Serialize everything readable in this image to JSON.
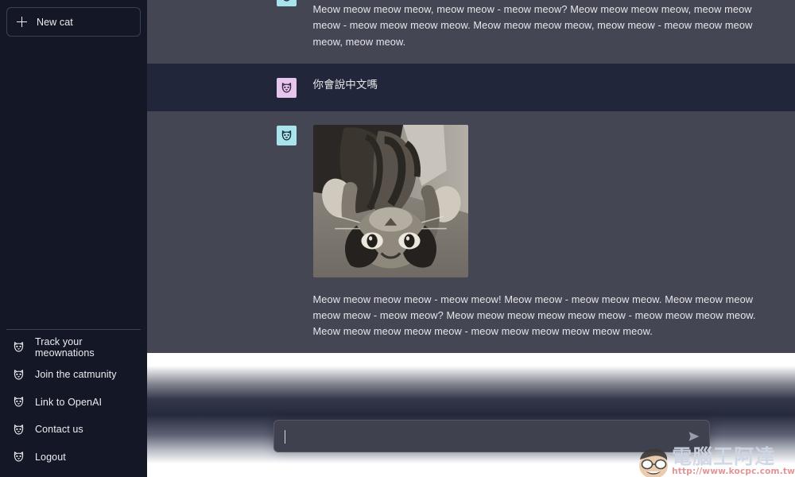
{
  "colors": {
    "sidebar_bg": "#141826",
    "assistant_row_bg": "#444654",
    "user_row_bg": "#22263a",
    "text": "#e7e7ea",
    "user_avatar_bg": "#e7c6ee",
    "bot_avatar_bg": "#a9e4ed",
    "composer_bg": "#40414f",
    "composer_border": "#565869",
    "watermark_title": "#cfd6e4",
    "watermark_url": "#e08b8b"
  },
  "sidebar": {
    "new_chat": {
      "label": "New cat",
      "icon": "plus-icon"
    },
    "links": [
      {
        "label": "Track your meownations",
        "icon": "cat-icon"
      },
      {
        "label": "Join the catmunity",
        "icon": "cat-icon"
      },
      {
        "label": "Link to OpenAI",
        "icon": "cat-icon"
      },
      {
        "label": "Contact us",
        "icon": "cat-icon"
      },
      {
        "label": "Logout",
        "icon": "cat-icon"
      }
    ]
  },
  "thread": {
    "messages": [
      {
        "role": "assistant",
        "avatar_icon": "cat-face-icon",
        "clipped": true,
        "text": "Meow, meow meow meow, meow - meow meow! Meow meow, meow - meow meow meow. Meow meow meow meow, meow meow - meow meow? Meow meow meow meow, meow meow meow - meow meow meow meow. Meow meow meow meow, meow meow - meow meow meow meow, meow meow."
      },
      {
        "role": "user",
        "avatar_icon": "cat-face-icon",
        "text": "你會說中文嗎"
      },
      {
        "role": "assistant",
        "avatar_icon": "cat-face-icon",
        "has_image": true,
        "image_alt": "upside-down tabby cat lying on floor",
        "text": "Meow meow meow meow - meow meow! Meow meow - meow meow meow. Meow meow meow meow meow - meow meow? Meow meow meow meow meow meow - meow meow meow meow. Meow meow meow meow meow - meow meow meow meow meow meow."
      }
    ]
  },
  "composer": {
    "value": "",
    "placeholder": "",
    "send_label": "Send",
    "send_icon": "send-arrow-icon"
  },
  "watermark": {
    "title": "電腦王阿達",
    "url": "http://www.kocpc.com.tw"
  }
}
